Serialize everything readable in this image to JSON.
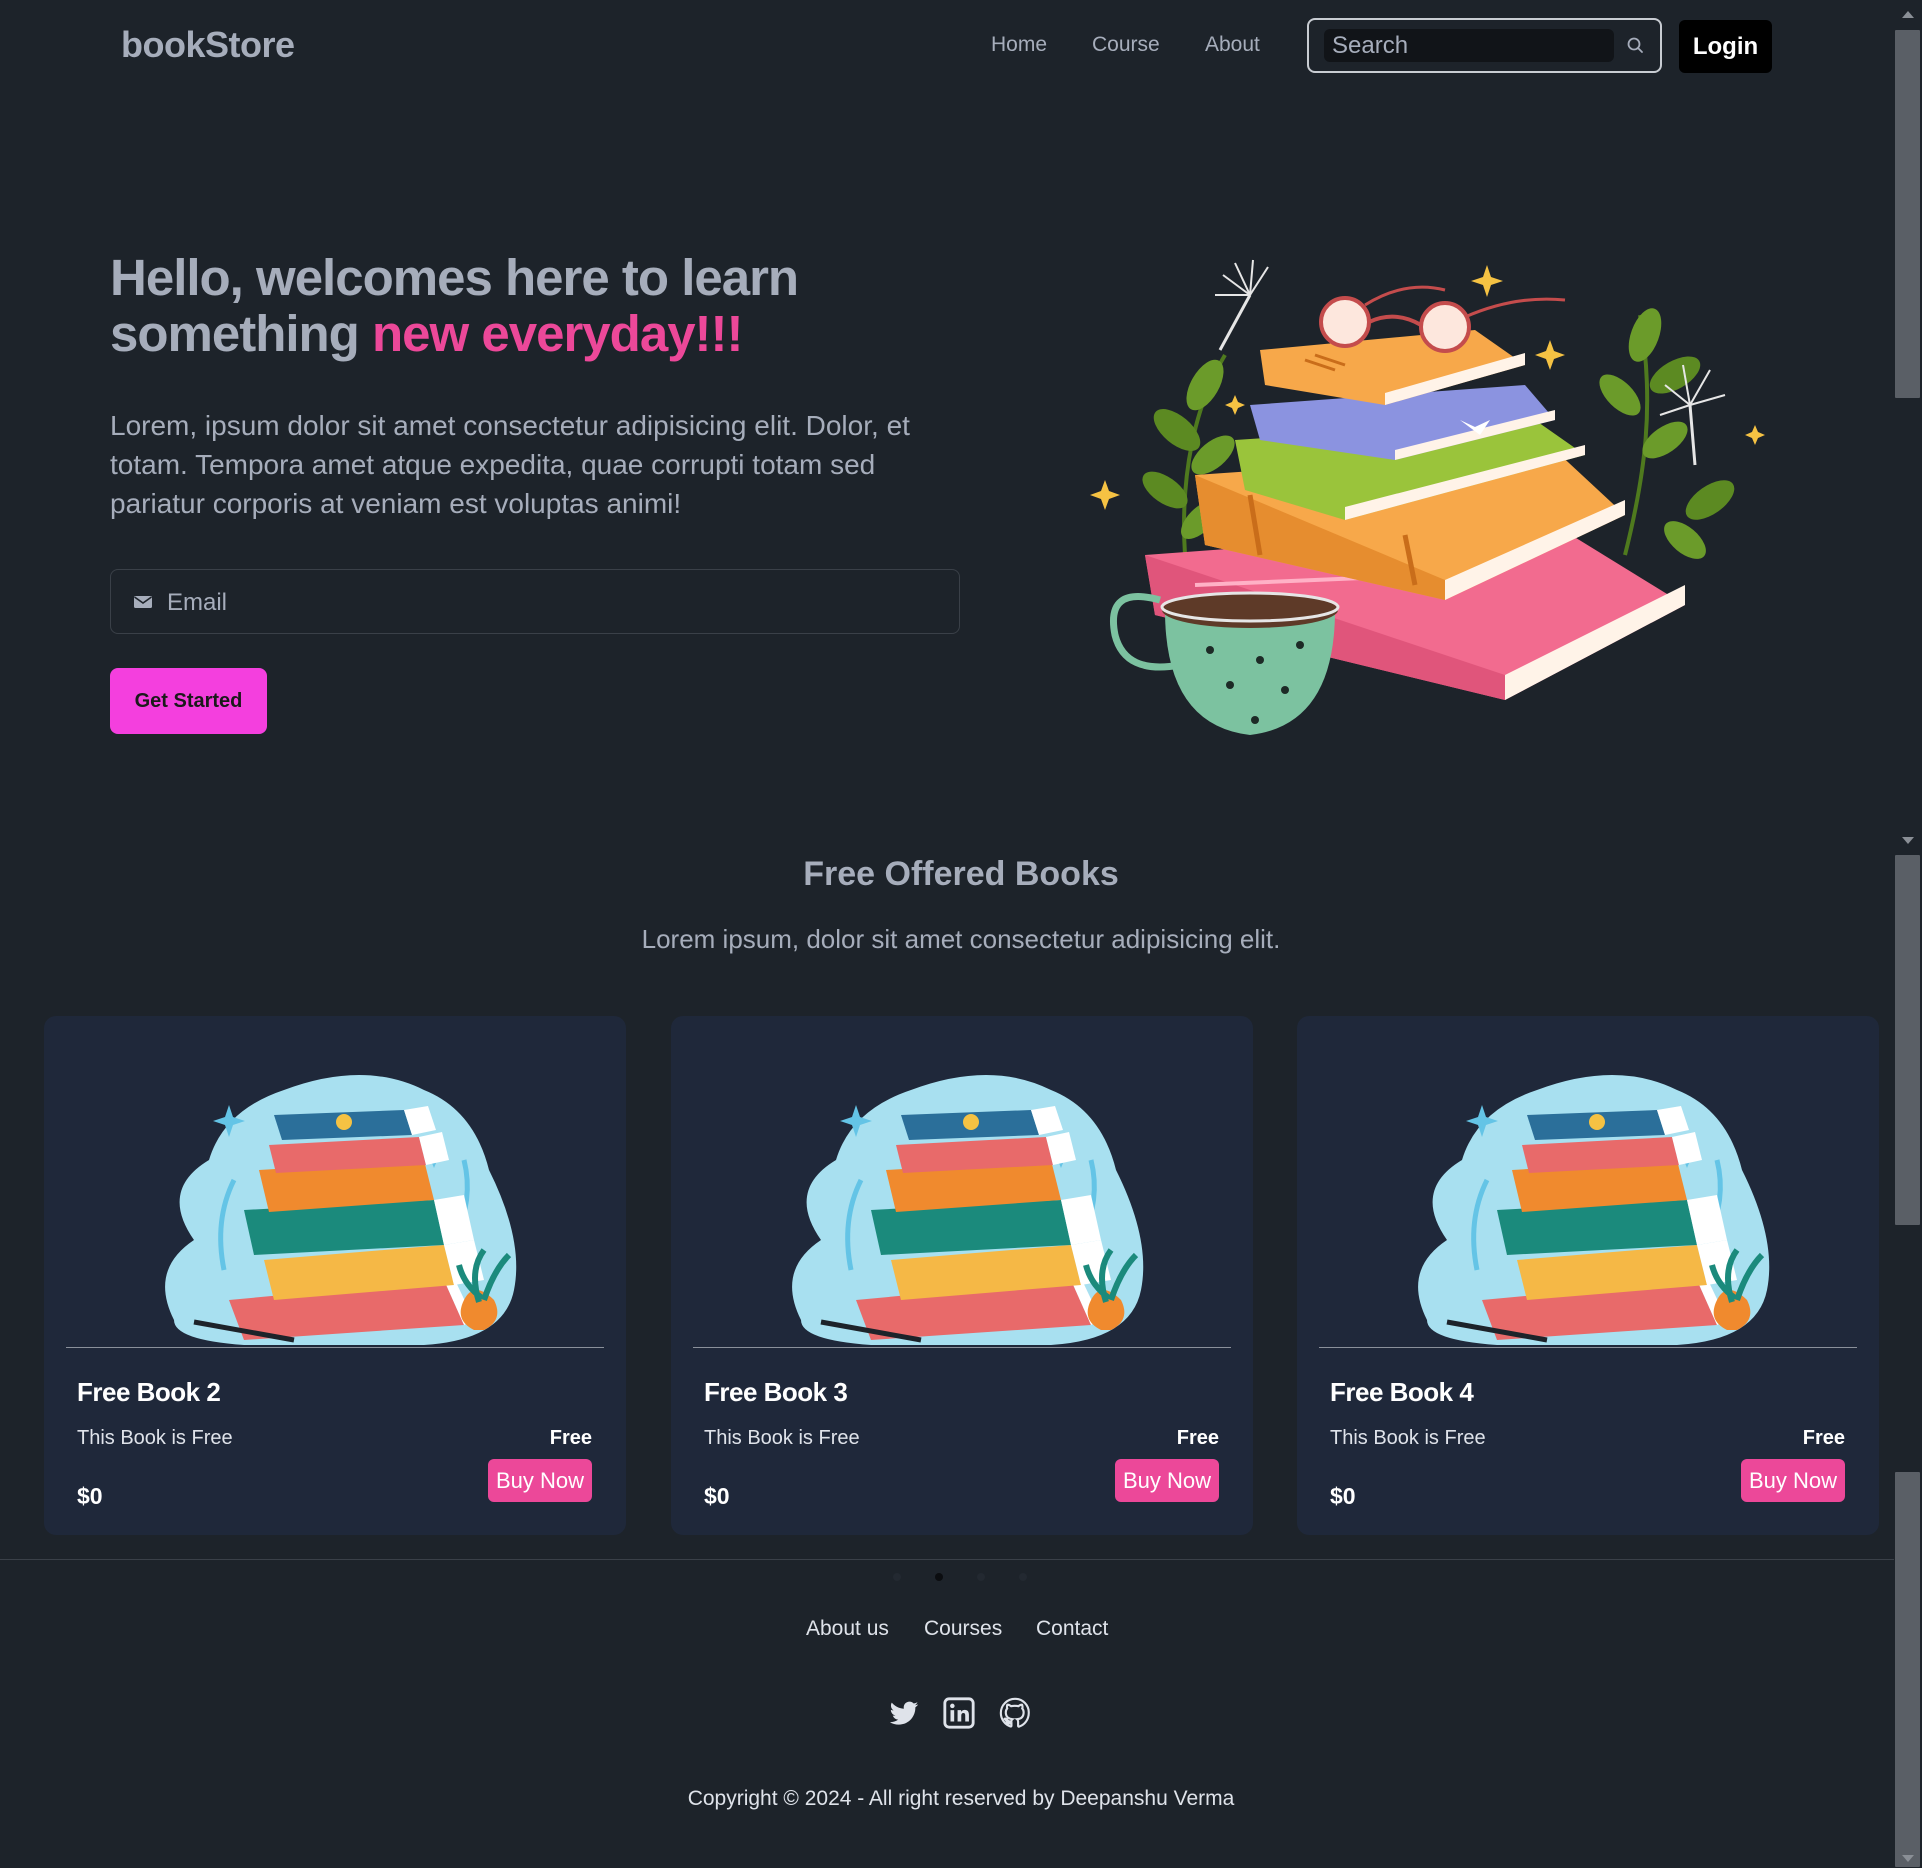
{
  "nav": {
    "brand": "bookStore",
    "links": [
      "Home",
      "Course",
      "About"
    ],
    "search_placeholder": "Search",
    "login_label": "Login"
  },
  "hero": {
    "title_plain": "Hello, welcomes here to learn something ",
    "title_accent": "new everyday!!!",
    "text": "Lorem, ipsum dolor sit amet consectetur adipisicing elit. Dolor, et totam. Tempora amet atque expedita, quae corrupti totam sed pariatur corporis at veniam est voluptas animi!",
    "email_placeholder": "Email",
    "cta_label": "Get Started"
  },
  "free_books": {
    "title": "Free Offered Books",
    "subtitle": "Lorem ipsum, dolor sit amet consectetur adipisicing elit.",
    "cards": [
      {
        "name": "Free Book 2",
        "description": "This Book is Free",
        "badge": "Free",
        "price": "$0",
        "button": "Buy Now"
      },
      {
        "name": "Free Book 3",
        "description": "This Book is Free",
        "badge": "Free",
        "price": "$0",
        "button": "Buy Now"
      },
      {
        "name": "Free Book 4",
        "description": "This Book is Free",
        "badge": "Free",
        "price": "$0",
        "button": "Buy Now"
      }
    ],
    "carousel_active_index": 1,
    "carousel_count": 4
  },
  "footer": {
    "links": [
      "About us",
      "Courses",
      "Contact"
    ],
    "social_icons": [
      "twitter-icon",
      "linkedin-icon",
      "github-icon"
    ],
    "copyright": "Copyright © 2024 - All right reserved by Deepanshu Verma"
  },
  "colors": {
    "background": "#1d232a",
    "text": "#a6adbb",
    "accent_pink": "#ec4899",
    "cta_pink": "#f43fde",
    "card_bg": "#1f283a"
  }
}
